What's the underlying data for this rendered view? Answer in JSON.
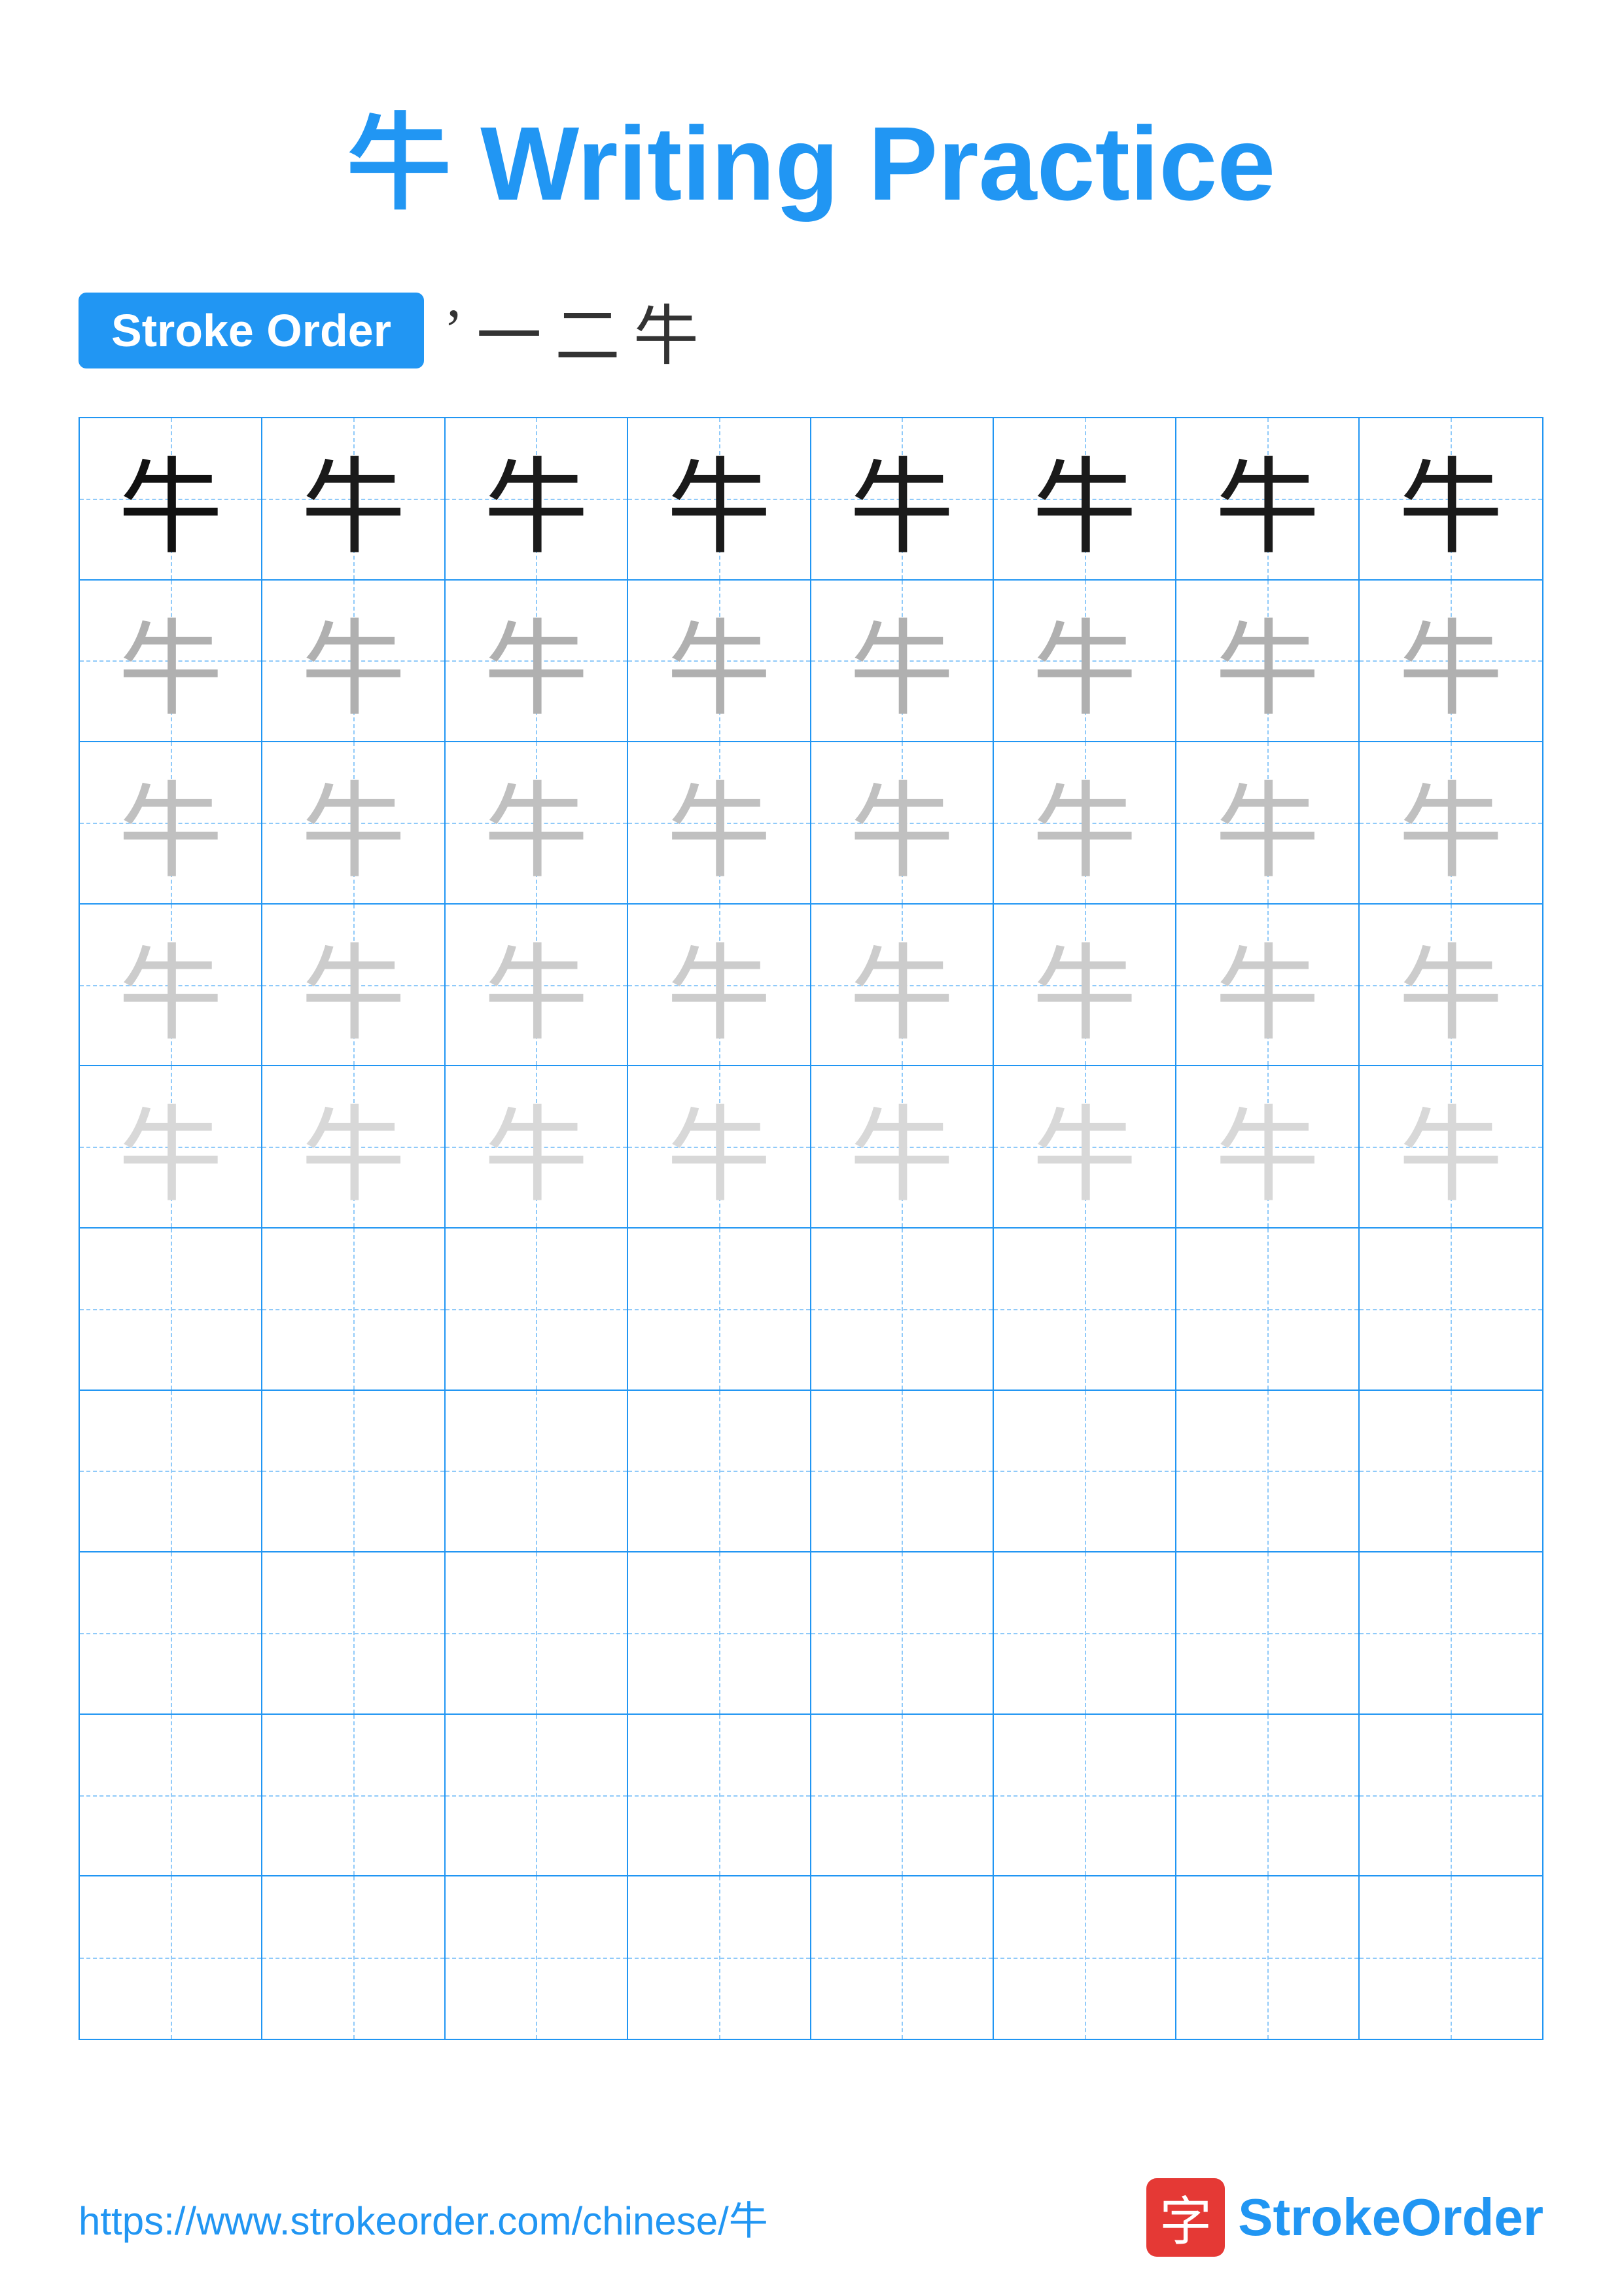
{
  "page": {
    "title": "牛 Writing Practice",
    "title_char": "牛",
    "title_text": " Writing Practice",
    "stroke_order_label": "Stroke Order",
    "stroke_order_strokes": [
      "'",
      "一",
      "二",
      "牛"
    ],
    "character": "牛",
    "grid_cols": 8,
    "grid_rows": 10,
    "practice_rows": 5,
    "empty_rows": 5,
    "footer_url": "https://www.strokeorder.com/chinese/牛",
    "footer_logo_char": "字",
    "footer_logo_name": "StrokeOrder"
  }
}
